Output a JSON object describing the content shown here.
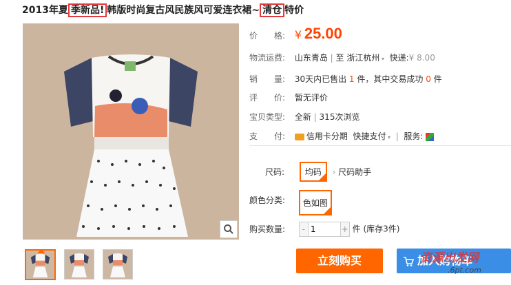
{
  "title": {
    "p1": "2013年夏",
    "p2": "季新品!",
    "p3": "韩版时尚复古风民族风可爱连衣裙~",
    "p4": "清仓",
    "p5": "特价"
  },
  "price": {
    "label": "价　　格:",
    "currency": "¥",
    "value": "25.00"
  },
  "shipping": {
    "label": "物流运费:",
    "from": "山东青岛",
    "sep": "|",
    "to_prefix": "至",
    "to": "浙江杭州",
    "express_label": "快递:",
    "express_price": "¥ 8.00"
  },
  "sales": {
    "label": "销　　量:",
    "text1": "30天内已售出 ",
    "count1": "1",
    "text2": " 件，其中交易成功 ",
    "count2": "0",
    "text3": " 件"
  },
  "review": {
    "label": "评　　价:",
    "value": "暂无评价"
  },
  "type": {
    "label": "宝贝类型:",
    "value": "全新",
    "sep": "|",
    "views": "315次浏览"
  },
  "payment": {
    "label": "支　　付:",
    "method1": "信用卡分期",
    "method2": "快捷支付",
    "services_label": "服务:"
  },
  "size": {
    "label": "尺码:",
    "option": "均码",
    "helper": "尺码助手"
  },
  "color": {
    "label": "颜色分类:",
    "option": "色如图"
  },
  "quantity": {
    "label": "购买数量:",
    "value": "1",
    "unit": "件 (库存3件)"
  },
  "buttons": {
    "buy": "立刻购买",
    "cart": "加入购物车"
  },
  "watermark": {
    "text1": "资源出发网",
    "text2": ".6pt.com"
  },
  "colors": {
    "accent": "#ff6600",
    "price": "#ff4400",
    "cart": "#3a8ee6"
  }
}
